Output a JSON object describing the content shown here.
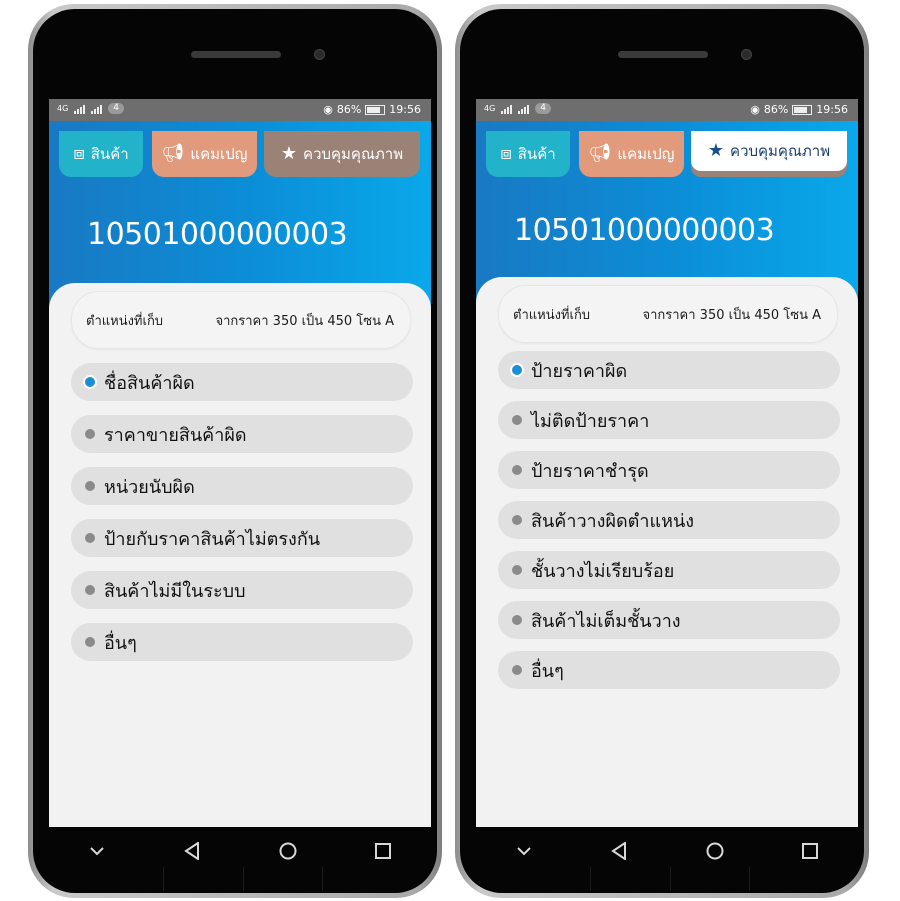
{
  "screens": [
    {
      "status": {
        "network": "4G",
        "sim": "4",
        "eye_indicator": "◉",
        "battery": "86%",
        "time": "19:56"
      },
      "tabs": [
        {
          "label": "สินค้า",
          "icon": "boxes-icon"
        },
        {
          "label": "แคมเปญ",
          "icon": "megaphone-icon"
        },
        {
          "label": "ควบคุมคุณภาพ",
          "icon": "star-icon"
        }
      ],
      "active_tab": null,
      "product_code": "10501000000003",
      "location": {
        "label": "ตำแหน่งที่เก็บ",
        "value": "จากราคา 350 เป็น 450 โซน A"
      },
      "options": [
        "ชื่อสินค้าผิด",
        "ราคาขายสินค้าผิด",
        "หน่วยนับผิด",
        "ป้ายกับราคาสินค้าไม่ตรงกัน",
        "สินค้าไม่มีในระบบ",
        "อื่นๆ"
      ],
      "selected_option": 0
    },
    {
      "status": {
        "network": "4G",
        "sim": "4",
        "eye_indicator": "◉",
        "battery": "86%",
        "time": "19:56"
      },
      "tabs": [
        {
          "label": "สินค้า",
          "icon": "boxes-icon"
        },
        {
          "label": "แคมเปญ",
          "icon": "megaphone-icon"
        },
        {
          "label": "ควบคุมคุณภาพ",
          "icon": "star-icon"
        }
      ],
      "active_tab": 2,
      "product_code": "10501000000003",
      "location": {
        "label": "ตำแหน่งที่เก็บ",
        "value": "จากราคา 350 เป็น 450 โซน A"
      },
      "options": [
        "ป้ายราคาผิด",
        "ไม่ติดป้ายราคา",
        "ป้ายราคาชำรุด",
        "สินค้าวางผิดตำแหน่ง",
        "ชั้นวางไม่เรียบร้อย",
        "สินค้าไม่เต็มชั้นวาง",
        "อื่นๆ"
      ],
      "selected_option": 0
    }
  ],
  "navbar": {
    "back": "back-triangle-icon",
    "home": "home-circle-icon",
    "recents": "recents-square-icon",
    "collapse": "chevron-down-icon"
  },
  "colors": {
    "header_start": "#1979c3",
    "header_end": "#0aa8ea",
    "tab_product": "#22b2c9",
    "tab_campaign": "#e29a7c",
    "tab_quality": "#9a8277",
    "radio_selected": "#1a8fd8",
    "radio_default": "#8a8a8a"
  }
}
